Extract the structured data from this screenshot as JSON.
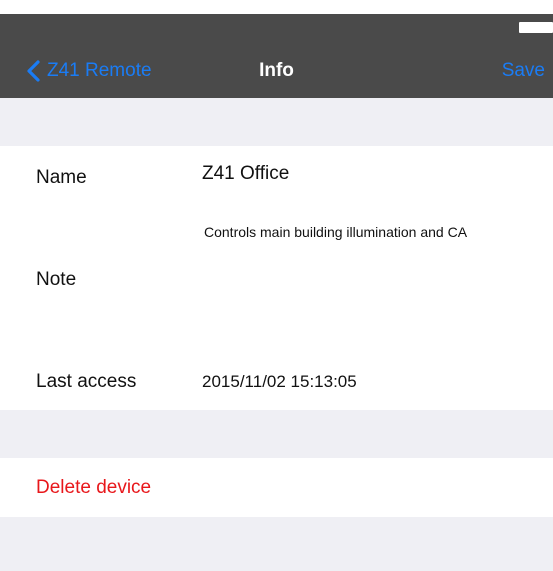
{
  "navbar": {
    "back_label": "Z41 Remote",
    "title": "Info",
    "save_label": "Save"
  },
  "fields": {
    "name_label": "Name",
    "name_value": "Z41 Office",
    "note_label": "Note",
    "note_value": "Controls main building illumination and CA",
    "last_access_label": "Last access",
    "last_access_value": "2015/11/02 15:13:05"
  },
  "actions": {
    "delete_label": "Delete device"
  },
  "colors": {
    "navbar_bg": "#4a4a4a",
    "accent_blue": "#1a7cf5",
    "destructive_red": "#e8171b",
    "grouped_bg": "#efeff4"
  }
}
